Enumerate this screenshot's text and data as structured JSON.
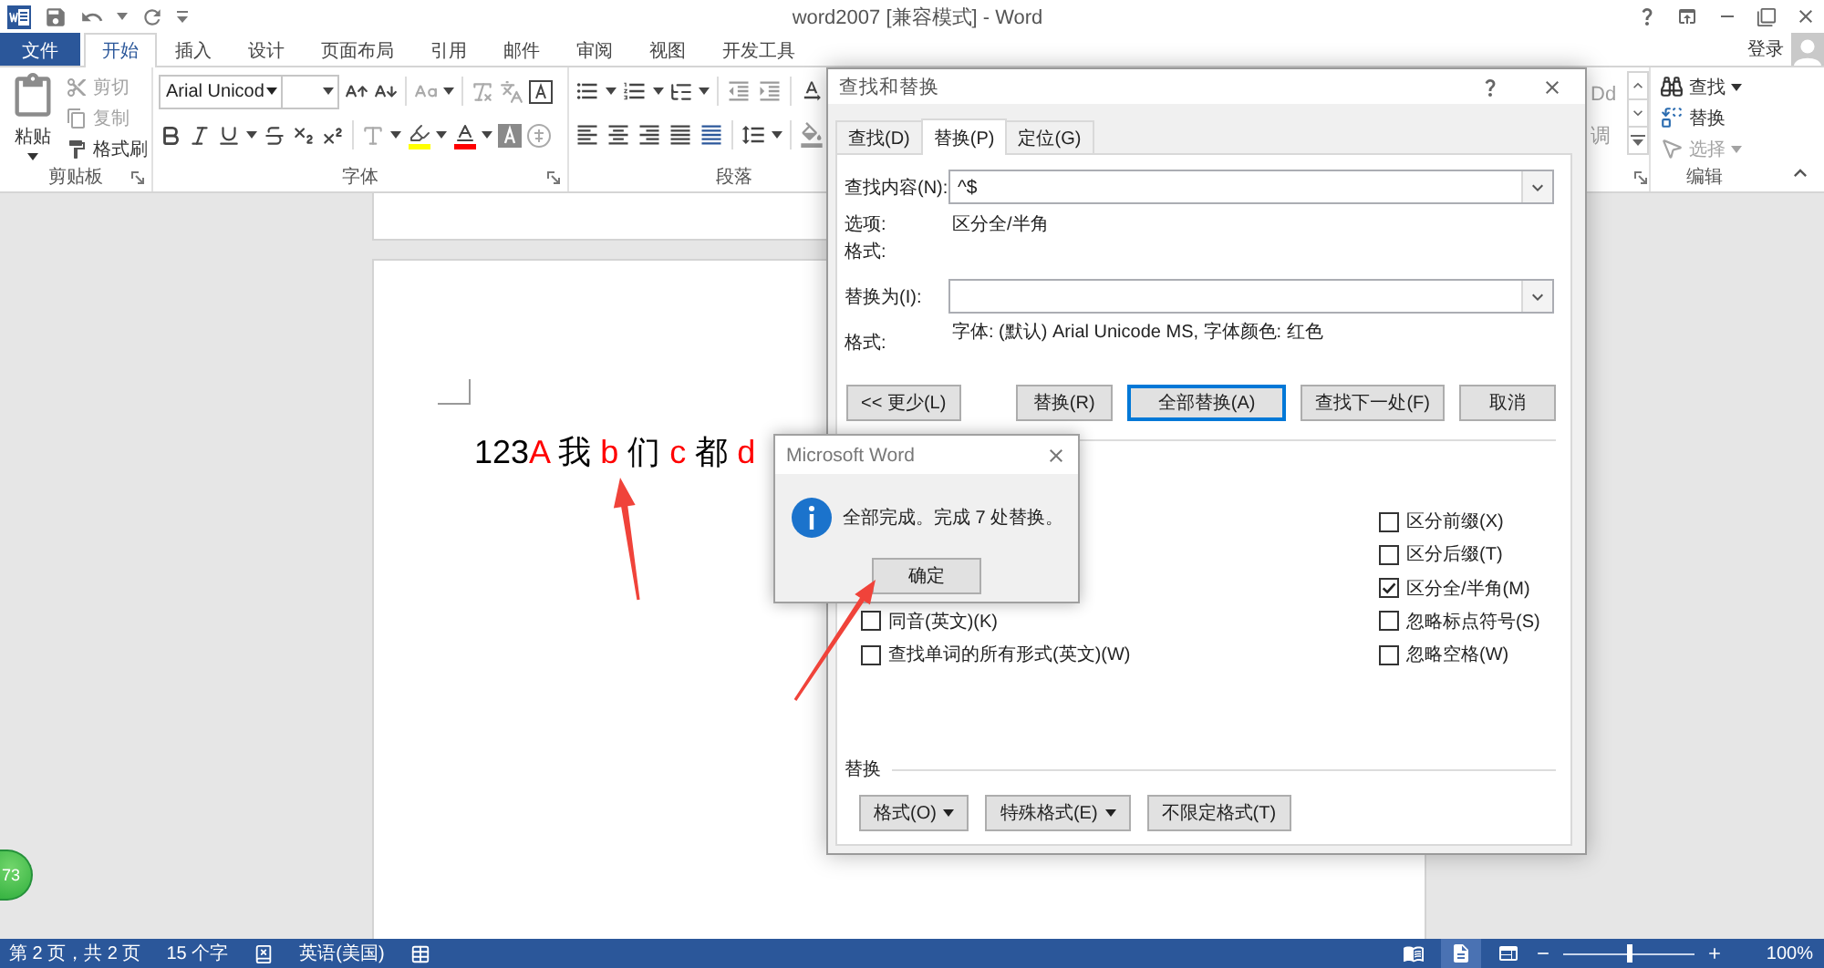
{
  "window": {
    "title": "word2007 [兼容模式] - Word"
  },
  "ribbon_tabs": [
    {
      "label": "文件",
      "kind": "file",
      "selected": false
    },
    {
      "label": "开始",
      "kind": "tab",
      "selected": true
    },
    {
      "label": "插入",
      "kind": "tab",
      "selected": false
    },
    {
      "label": "设计",
      "kind": "tab",
      "selected": false
    },
    {
      "label": "页面布局",
      "kind": "tab",
      "selected": false
    },
    {
      "label": "引用",
      "kind": "tab",
      "selected": false
    },
    {
      "label": "邮件",
      "kind": "tab",
      "selected": false
    },
    {
      "label": "审阅",
      "kind": "tab",
      "selected": false
    },
    {
      "label": "视图",
      "kind": "tab",
      "selected": false
    },
    {
      "label": "开发工具",
      "kind": "tab",
      "selected": false
    }
  ],
  "account": {
    "label": "登录"
  },
  "clipboard_group": {
    "label": "剪贴板",
    "paste": "粘贴",
    "items": [
      {
        "label": "剪切",
        "kind": "cut",
        "disabled": true
      },
      {
        "label": "复制",
        "kind": "copy",
        "disabled": true
      },
      {
        "label": "格式刷",
        "kind": "format_painter",
        "disabled": false
      }
    ]
  },
  "font_group": {
    "label": "字体",
    "font_name": "Arial Unicod"
  },
  "paragraph_group": {
    "label": "段落"
  },
  "styles_gallery": {
    "items": [
      "Dd",
      "调"
    ]
  },
  "editing_group": {
    "label": "编辑",
    "items": [
      {
        "label": "查找",
        "kind": "find",
        "dropdown": true,
        "disabled": false
      },
      {
        "label": "替换",
        "kind": "replace",
        "dropdown": false,
        "disabled": false
      },
      {
        "label": "选择",
        "kind": "select",
        "dropdown": true,
        "disabled": true
      }
    ]
  },
  "document": {
    "runs": [
      {
        "text": "123",
        "color": "#000000"
      },
      {
        "text": "A",
        "color": "#ff0000"
      },
      {
        "text": " 我 ",
        "color": "#000000"
      },
      {
        "text": "b",
        "color": "#ff0000"
      },
      {
        "text": " 们 ",
        "color": "#000000"
      },
      {
        "text": "c",
        "color": "#ff0000"
      },
      {
        "text": " 都 ",
        "color": "#000000"
      },
      {
        "text": "d",
        "color": "#ff0000"
      }
    ]
  },
  "find_replace_dialog": {
    "title": "查找和替换",
    "tabs": [
      {
        "label": "查找(D)",
        "selected": false
      },
      {
        "label": "替换(P)",
        "selected": true
      },
      {
        "label": "定位(G)",
        "selected": false
      }
    ],
    "find_what": {
      "label": "查找内容(N):",
      "value": "^$"
    },
    "options": {
      "label": "选项:",
      "value": "区分全/半角"
    },
    "find_format": {
      "label": "格式:"
    },
    "replace_with": {
      "label": "替换为(I):"
    },
    "replace_format": {
      "label": "格式:",
      "value": "字体: (默认) Arial Unicode MS, 字体颜色: 红色"
    },
    "buttons": [
      {
        "label": "<< 更少(L)",
        "default": false
      },
      {
        "label": "替换(R)",
        "default": false
      },
      {
        "label": "全部替换(A)",
        "default": true
      },
      {
        "label": "查找下一处(F)",
        "default": false
      },
      {
        "label": "取消",
        "default": false
      }
    ],
    "search_options_left": [
      {
        "label": "同音(英文)(K)",
        "checked": false
      },
      {
        "label": "查找单词的所有形式(英文)(W)",
        "checked": false
      }
    ],
    "search_options_right": [
      {
        "label": "区分前缀(X)",
        "checked": false
      },
      {
        "label": "区分后缀(T)",
        "checked": false
      },
      {
        "label": "区分全/半角(M)",
        "checked": true
      },
      {
        "label": "忽略标点符号(S)",
        "checked": false
      },
      {
        "label": "忽略空格(W)",
        "checked": false
      }
    ],
    "replace_section": {
      "label": "替换",
      "buttons": [
        {
          "label": "格式(O)",
          "dropdown": true
        },
        {
          "label": "特殊格式(E)",
          "dropdown": true
        },
        {
          "label": "不限定格式(T)",
          "dropdown": false
        }
      ]
    }
  },
  "message_box": {
    "title": "Microsoft Word",
    "message": "全部完成。完成 7 处替换。",
    "button": "确定"
  },
  "status_bar": {
    "page": "第 2 页，共 2 页",
    "word_count": "15 个字",
    "language": "英语(美国)",
    "views": [
      {
        "kind": "read",
        "selected": false
      },
      {
        "kind": "print",
        "selected": true
      },
      {
        "kind": "web",
        "selected": false
      }
    ],
    "zoom": {
      "label": "100%",
      "level": 0.5
    }
  },
  "floating_counter": {
    "label": "73"
  }
}
